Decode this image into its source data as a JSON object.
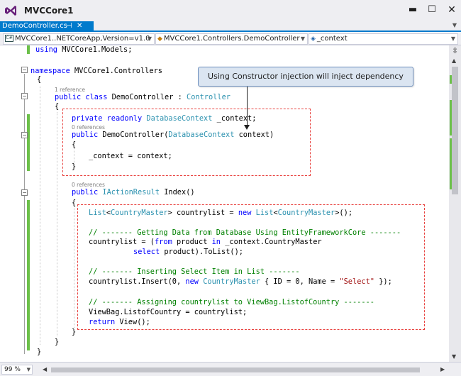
{
  "window": {
    "title": "MVCCore1",
    "minimize_glyph": "▬",
    "maximize_glyph": "☐",
    "close_glyph": "✕"
  },
  "tab": {
    "label": "DemoController.cs",
    "pin_glyph": "⊣",
    "close_glyph": "✕"
  },
  "nav": {
    "project_badge": "C#",
    "project": "MVCCore1..NETCoreApp,Version=v1.0",
    "type": "MVCCore1.Controllers.DemoController",
    "member": "_context"
  },
  "code": {
    "using_kw": "using",
    "using_ns": " MVCCore1.Models;",
    "ns_kw": "namespace",
    "ns_name": " MVCCore1.Controllers",
    "open1": "{",
    "ref_class": "1 reference",
    "class_public": "public",
    "class_class": "class",
    "class_name": " DemoController : ",
    "class_base": "Controller",
    "open2": "{",
    "field_mod1": "private",
    "field_mod2": "readonly",
    "field_type": "DatabaseContext",
    "field_name": " _context;",
    "ref_ctor": "0 references",
    "ctor_public": "public",
    "ctor_name": " DemoController(",
    "ctor_ptype": "DatabaseContext",
    "ctor_pname": " context)",
    "open3": "{",
    "assign": "_context = context;",
    "close3": "}",
    "ref_index": "0 references",
    "idx_public": "public",
    "idx_type": "IActionResult",
    "idx_name": " Index()",
    "open4": "{",
    "l1_type": "List",
    "l1_lt": "<",
    "l1_arg": "CountryMaster",
    "l1_mid": "> countrylist = ",
    "l1_new": "new",
    "l1_type2": "List",
    "l1_lt2": "<",
    "l1_arg2": "CountryMaster",
    "l1_end": ">();",
    "comment1": "// ------- Getting Data from Database Using EntityFrameworkCore -------",
    "q1_start": "countrylist = (",
    "q1_from": "from",
    "q1_mid": " product ",
    "q1_in": "in",
    "q1_end": " _context.CountryMaster",
    "q2_select": "select",
    "q2_end": " product).ToList();",
    "comment2": "// ------- Inserting Select Item in List -------",
    "ins_start": "countrylist.Insert(0, ",
    "ins_new": "new",
    "ins_type": "CountryMaster",
    "ins_mid": " { ID = 0, Name = ",
    "ins_str": "\"Select\"",
    "ins_end": " });",
    "comment3": "// ------- Assigning countrylist to ViewBag.ListofCountry -------",
    "viewbag": "ViewBag.ListofCountry = countrylist;",
    "ret_kw": "return",
    "ret_rest": " View();",
    "close4": "}",
    "close2": "}",
    "close1": "}"
  },
  "callout": {
    "text": "Using Constructor  injection will inject dependency"
  },
  "status": {
    "zoom": "99 %"
  },
  "colors": {
    "accent": "#007acc",
    "keyword": "#0000ff",
    "type": "#2b91af",
    "comment": "#008000",
    "string": "#a31515",
    "change_bar": "#6cc04a",
    "annotation_dash": "#e8423f",
    "callout_fill": "#dbe5f1"
  },
  "icons": {
    "app": "visual-studio-logo-icon",
    "class": "class-icon",
    "field": "field-icon"
  }
}
